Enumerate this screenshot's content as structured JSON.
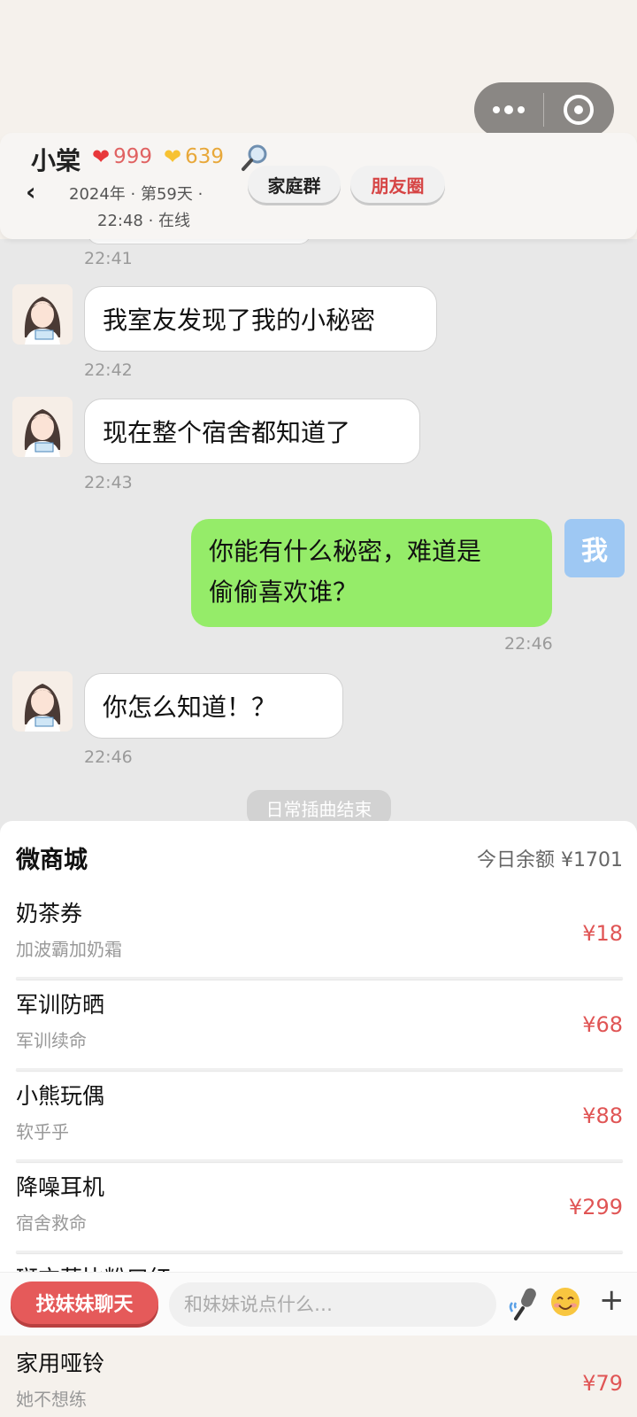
{
  "header": {
    "back": "‹",
    "name": "小棠",
    "affection": "999",
    "gold": "639",
    "date_line": "2024年 · 第59天 ·",
    "time_line": "22:48 · 在线",
    "family_group": "家庭群",
    "moments": "朋友圈"
  },
  "chat": {
    "time_top": "22:41",
    "messages": [
      {
        "text": "我室友发现了我的小秘密",
        "time": "22:42"
      },
      {
        "text": "现在整个宿舍都知道了",
        "time": "22:43"
      },
      {
        "text_line1": "你能有什么秘密，难道是",
        "text_line2": "偷偷喜欢谁？",
        "time": "22:46",
        "avatar_label": "我"
      },
      {
        "text": "你怎么知道！？",
        "time": "22:46"
      }
    ],
    "episode_end": "日常插曲结束"
  },
  "shop": {
    "title": "微商城",
    "balance": "今日余额 ¥1701",
    "items": [
      {
        "name": "奶茶券",
        "desc": "加波霸加奶霜",
        "price": "¥18"
      },
      {
        "name": "军训防晒",
        "desc": "军训续命",
        "price": "¥68"
      },
      {
        "name": "小熊玩偶",
        "desc": "软乎乎",
        "price": "¥88"
      },
      {
        "name": "降噪耳机",
        "desc": "宿舍救命",
        "price": "¥299"
      },
      {
        "name": "斑方草比粉口红",
        "desc": "",
        "price": ""
      },
      {
        "name": "家用哑铃",
        "desc": "她不想练",
        "price": "¥79"
      }
    ]
  },
  "input": {
    "find_button": "找妹妹聊天",
    "placeholder": "和妹妹说点什么…",
    "plus": "+"
  },
  "colors": {
    "accent_red": "#e55a5a",
    "my_bubble": "#95ec69",
    "me_avatar": "#9ec8f3"
  }
}
